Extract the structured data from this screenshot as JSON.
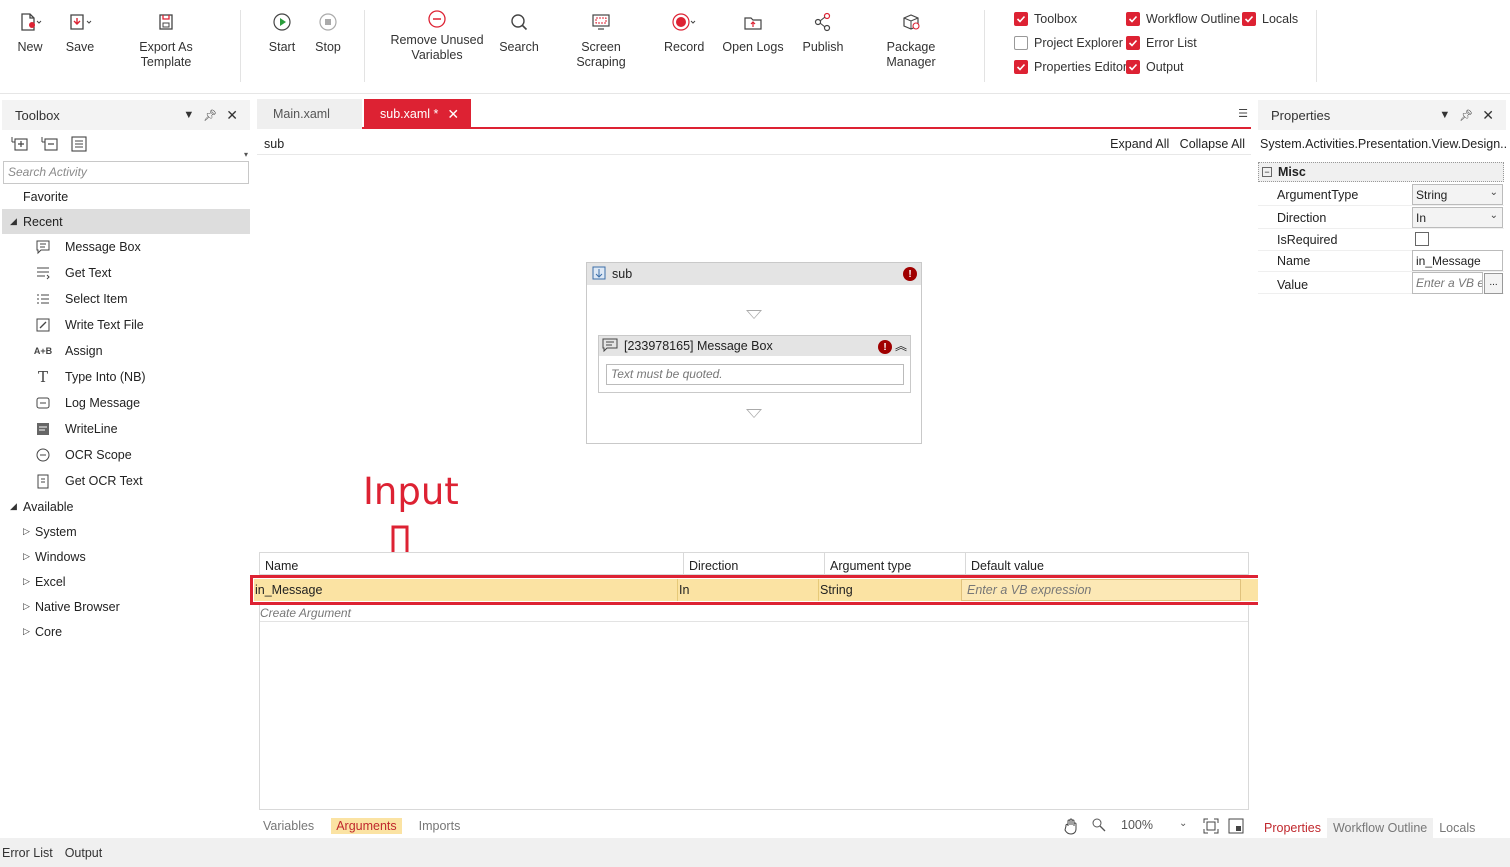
{
  "ribbon": {
    "buttons": [
      {
        "label": "New",
        "icon": "new-file-icon"
      },
      {
        "label": "Save",
        "icon": "save-icon"
      },
      {
        "label": "Export As Template",
        "icon": "export-template-icon"
      },
      {
        "label": "Start",
        "icon": "play-icon"
      },
      {
        "label": "Stop",
        "icon": "stop-icon"
      },
      {
        "label": "Remove Unused Variables",
        "icon": "remove-icon"
      },
      {
        "label": "Search",
        "icon": "search-icon"
      },
      {
        "label": "Screen Scraping",
        "icon": "screen-scraping-icon"
      },
      {
        "label": "Record",
        "icon": "record-icon"
      },
      {
        "label": "Open Logs",
        "icon": "open-logs-icon"
      },
      {
        "label": "Publish",
        "icon": "publish-icon"
      },
      {
        "label": "Package Manager",
        "icon": "package-icon"
      }
    ],
    "remove_line1": "Remove Unused",
    "remove_line2": "Variables",
    "checks": [
      {
        "label": "Toolbox",
        "checked": true
      },
      {
        "label": "Project Explorer",
        "checked": false
      },
      {
        "label": "Properties Editor",
        "checked": true
      },
      {
        "label": "Workflow Outline",
        "checked": true
      },
      {
        "label": "Error List",
        "checked": true
      },
      {
        "label": "Output",
        "checked": true
      },
      {
        "label": "Locals",
        "checked": true
      }
    ]
  },
  "toolbox": {
    "title": "Toolbox",
    "search_placeholder": "Search Activity",
    "favorite": "Favorite",
    "recent": "Recent",
    "recent_items": [
      "Message Box",
      "Get Text",
      "Select Item",
      "Write Text File",
      "Assign",
      "Type Into (NB)",
      "Log Message",
      "WriteLine",
      "OCR Scope",
      "Get OCR Text"
    ],
    "available": "Available",
    "available_items": [
      "System",
      "Windows",
      "Excel",
      "Native Browser",
      "Core"
    ]
  },
  "designer": {
    "tabs": [
      {
        "label": "Main.xaml",
        "active": false
      },
      {
        "label": "sub.xaml *",
        "active": true
      }
    ],
    "breadcrumb": "sub",
    "expand_all": "Expand All",
    "collapse_all": "Collapse All",
    "sequence_title": "sub",
    "activity_title": "[233978165] Message Box",
    "activity_input_placeholder": "Text must be quoted.",
    "annotation": "Input"
  },
  "arguments": {
    "columns": [
      "Name",
      "Direction",
      "Argument type",
      "Default value"
    ],
    "row": {
      "name": "in_Message",
      "direction": "In",
      "type": "String",
      "default_placeholder": "Enter a VB expression"
    },
    "create_label": "Create Argument"
  },
  "bottom_tabs": {
    "tabs": [
      "Variables",
      "Arguments",
      "Imports"
    ],
    "active": "Arguments",
    "zoom": "100%"
  },
  "properties": {
    "title": "Properties",
    "type_name": "System.Activities.Presentation.View.Design...",
    "category": "Misc",
    "rows": [
      {
        "label": "ArgumentType",
        "value": "String"
      },
      {
        "label": "Direction",
        "value": "In"
      },
      {
        "label": "IsRequired",
        "value": ""
      },
      {
        "label": "Name",
        "value": "in_Message"
      },
      {
        "label": "Value",
        "value": "Enter a VB e"
      }
    ],
    "tabs": [
      "Properties",
      "Workflow Outline",
      "Locals"
    ]
  },
  "status": {
    "tabs": [
      "Error List",
      "Output"
    ]
  },
  "colors": {
    "accent": "#dd2233",
    "highlight": "#fbe3a3",
    "error": "#a00000"
  }
}
